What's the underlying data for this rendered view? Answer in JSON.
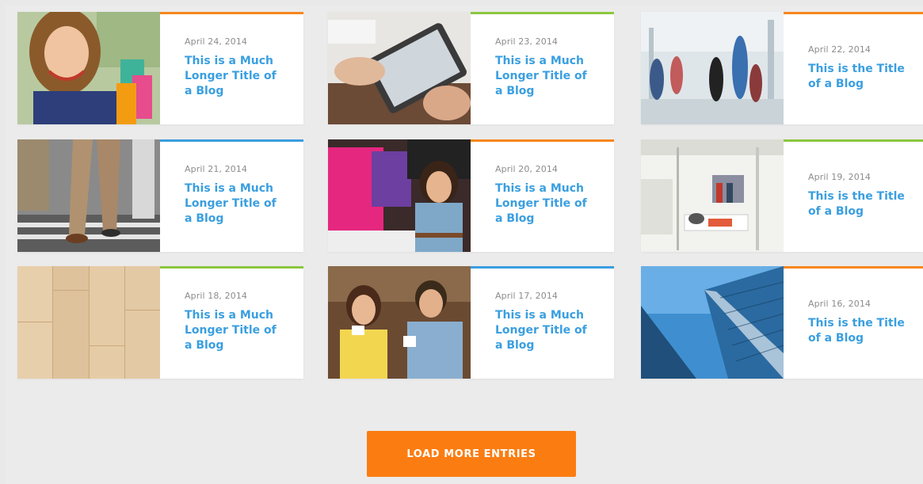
{
  "posts": [
    {
      "date": "April 24, 2014",
      "title": "This is a Much Longer Title of a Blog",
      "accent": "#f7861d",
      "image": "woman-with-shopping-bags"
    },
    {
      "date": "April 23, 2014",
      "title": "This is a Much Longer Title of a Blog",
      "accent": "#8cc63f",
      "image": "hands-using-tablet"
    },
    {
      "date": "April 22, 2014",
      "title": "This is the Title of a Blog",
      "accent": "#f7861d",
      "image": "shopping-mall-crowd"
    },
    {
      "date": "April 21, 2014",
      "title": "This is a Much Longer Title of a Blog",
      "accent": "#3b9de0",
      "image": "people-walking-legs"
    },
    {
      "date": "April 20, 2014",
      "title": "This is a Much Longer Title of a Blog",
      "accent": "#f7861d",
      "image": "woman-shopping-clothes"
    },
    {
      "date": "April 19, 2014",
      "title": "This is the Title of a Blog",
      "accent": "#8cc63f",
      "image": "store-interior"
    },
    {
      "date": "April 18, 2014",
      "title": "This is a Much Longer Title of a Blog",
      "accent": "#8cc63f",
      "image": "wood-floor-texture"
    },
    {
      "date": "April 17, 2014",
      "title": "This is a Much Longer Title of a Blog",
      "accent": "#3b9de0",
      "image": "couple-drinking-coffee"
    },
    {
      "date": "April 16, 2014",
      "title": "This is the Title of a Blog",
      "accent": "#f7861d",
      "image": "glass-skyscraper"
    }
  ],
  "load_more": {
    "label": "LOAD MORE ENTRIES",
    "color": "#fb7d12"
  },
  "colors": {
    "background": "#ebebeb",
    "title_blue": "#3a9fe0",
    "date_gray": "#8c8c8c"
  }
}
